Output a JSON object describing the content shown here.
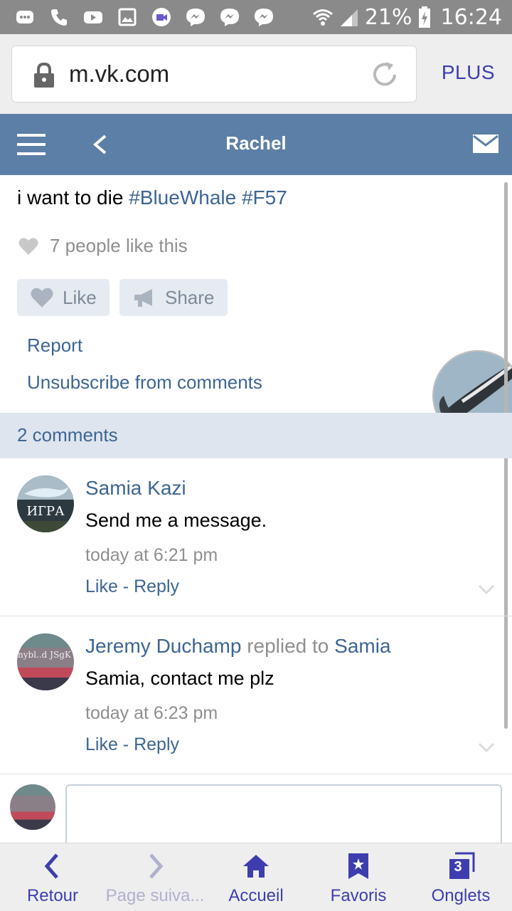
{
  "status_bar": {
    "battery_percent": "21%",
    "time": "16:24",
    "background_color": "#8a8a8a"
  },
  "browser": {
    "url": "m.vk.com",
    "menu_label": "PLUS"
  },
  "vk_header": {
    "title": "Rachel",
    "background_color": "#5b7fa6"
  },
  "post": {
    "text": "i want to die ",
    "hashtags": [
      "#BlueWhale",
      "#F57"
    ],
    "likes_text": "7 people like this",
    "like_label": "Like",
    "share_label": "Share",
    "report_label": "Report",
    "unsubscribe_label": "Unsubscribe from comments"
  },
  "comments_section": {
    "count_label": "2 comments",
    "items": [
      {
        "author": "Samia Kazi",
        "text": "Send me a message.",
        "time": "today at 6:21 pm",
        "actions": "Like - Reply",
        "avatar_caption": "ИГРА"
      },
      {
        "author": "Jeremy Duchamp",
        "replied_label": "replied to",
        "reply_target": "Samia",
        "text": "Samia, contact me plz",
        "time": "today at 6:23 pm",
        "actions": "Like - Reply",
        "avatar_caption": "Anonybl..d JSgK Rev"
      }
    ]
  },
  "reply_box": {
    "placeholder": ""
  },
  "bottom_nav": {
    "back": "Retour",
    "next": "Page suiva...",
    "home": "Accueil",
    "favorites": "Favoris",
    "tabs": "Onglets",
    "tabs_count": "3",
    "accent_color": "#3d3db0"
  }
}
